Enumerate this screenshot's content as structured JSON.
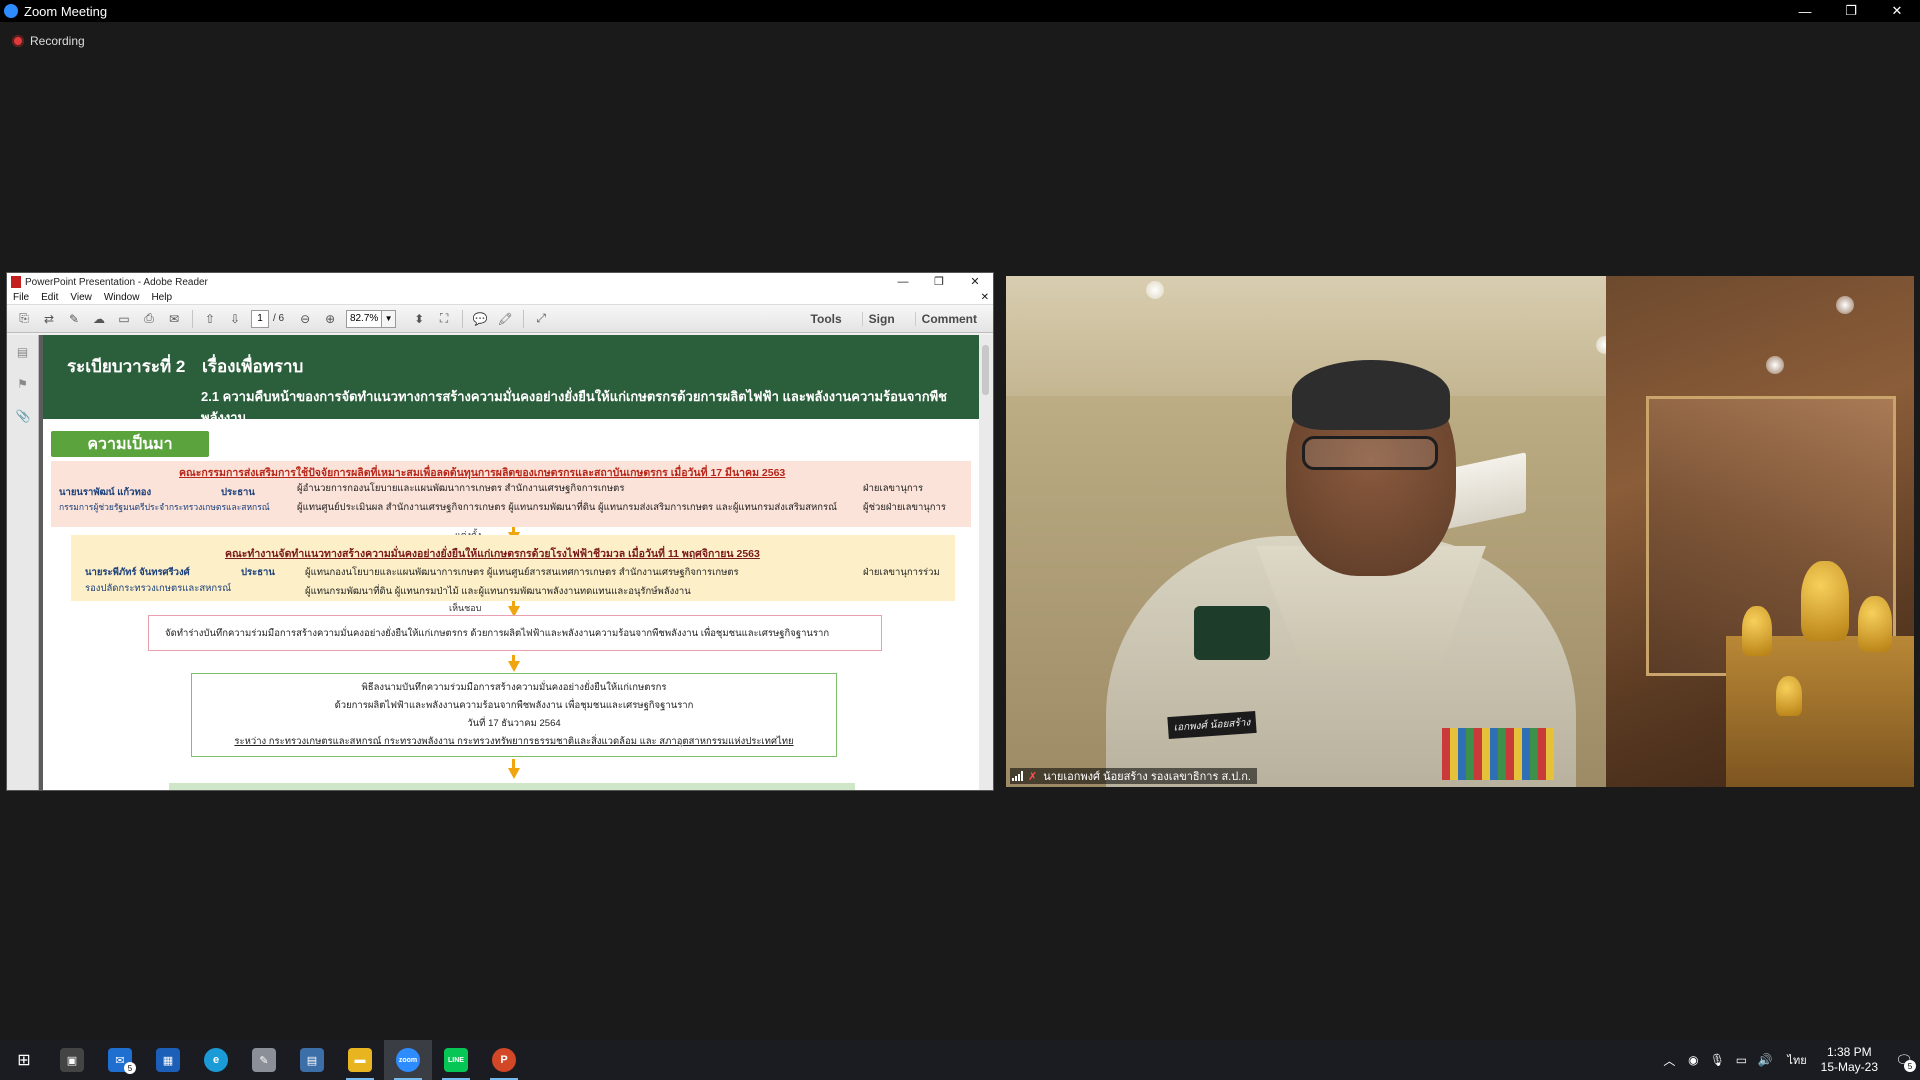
{
  "window": {
    "title": "Zoom Meeting",
    "minimize": "—",
    "restore": "❐",
    "close": "✕"
  },
  "recording": {
    "label": "Recording"
  },
  "adobe": {
    "title": "PowerPoint Presentation - Adobe Reader",
    "menu": [
      "File",
      "Edit",
      "View",
      "Window",
      "Help"
    ],
    "menu_close": "✕",
    "page_current": "1",
    "page_total": "/ 6",
    "zoom": "82.7%",
    "right_tools": [
      "Tools",
      "Sign",
      "Comment"
    ]
  },
  "slide": {
    "agenda": "ระเบียบวาระที่ 2",
    "agenda_topic": "เรื่องเพื่อทราบ",
    "subtitle": "2.1 ความคืบหน้าของการจัดทำแนวทางการสร้างความมั่นคงอย่างยั่งยืนให้แก่เกษตรกรด้วยการผลิตไฟฟ้า และพลังงานความร้อนจากพืชพลังงาน",
    "tag": "ความเป็นมา",
    "box1": {
      "head": "คณะกรรมการส่งเสริมการใช้ปัจจัยการผลิตที่เหมาะสมเพื่อลดต้นทุนการผลิตของเกษตรกรและสถาบันเกษตรกร เมื่อวันที่ 17 มีนาคม 2563",
      "chair_name": "นายนราพัฒน์ แก้วทอง",
      "chair_role": "ประธาน",
      "chair_pos": "กรรมการผู้ช่วยรัฐมนตรีประจำกระทรวงเกษตรและสหกรณ์",
      "line1": "ผู้อำนวยการกองนโยบายและแผนพัฒนาการเกษตร สำนักงานเศรษฐกิจการเกษตร",
      "line2": "ผู้แทนศูนย์ประเมินผล สำนักงานเศรษฐกิจการเกษตร ผู้แทนกรมพัฒนาที่ดิน ผู้แทนกรมส่งเสริมการเกษตร และผู้แทนกรมส่งเสริมสหกรณ์",
      "sec1": "ฝ่ายเลขานุการ",
      "sec2": "ผู้ช่วยฝ่ายเลขานุการ"
    },
    "label_appoint": "แต่งตั้ง",
    "box2": {
      "head": "คณะทำงานจัดทำแนวทางสร้างความมั่นคงอย่างยั่งยืนให้แก่เกษตรกรด้วยโรงไฟฟ้าชีวมวล เมื่อวันที่ 11 พฤศจิกายน 2563",
      "chair_name": "นายระพีภัทร์ จันทรศรีวงศ์",
      "chair_role": "ประธาน",
      "chair_pos": "รองปลัดกระทรวงเกษตรและสหกรณ์",
      "line1": "ผู้แทนกองนโยบายและแผนพัฒนาการเกษตร ผู้แทนศูนย์สารสนเทศการเกษตร สำนักงานเศรษฐกิจการเกษตร",
      "line2": "ผู้แทนกรมพัฒนาที่ดิน ผู้แทนกรมป่าไม้ และผู้แทนกรมพัฒนาพลังงานทดแทนและอนุรักษ์พลังงาน",
      "sec": "ฝ่ายเลขานุการร่วม"
    },
    "label_approve": "เห็นชอบ",
    "box3": "จัดทำร่างบันทึกความร่วมมือการสร้างความมั่นคงอย่างยั่งยืนให้แก่เกษตรกร ด้วยการผลิตไฟฟ้าและพลังงานความร้อนจากพืชพลังงาน เพื่อชุมชนและเศรษฐกิจฐานราก",
    "box4": {
      "l1": "พิธีลงนามบันทึกความร่วมมือการสร้างความมั่นคงอย่างยั่งยืนให้แก่เกษตรกร",
      "l2": "ด้วยการผลิตไฟฟ้าและพลังงานความร้อนจากพืชพลังงาน เพื่อชุมชนและเศรษฐกิจฐานราก",
      "l3": "วันที่ 17 ธันวาคม 2564",
      "l4": "ระหว่าง กระทรวงเกษตรและสหกรณ์ กระทรวงพลังงาน กระทรวงทรัพยากรธรรมชาติและสิ่งแวดล้อม และ สภาอุตสาหกรรมแห่งประเทศไทย"
    }
  },
  "video": {
    "participant": "นายเอกพงศ์ น้อยสร้าง รองเลขาธิการ ส.ป.ก.",
    "nametag": "เอกพงศ์ น้อยสร้าง"
  },
  "taskbar": {
    "apps": [
      {
        "name": "start",
        "label": "⊞"
      },
      {
        "name": "terminal",
        "label": "▣"
      },
      {
        "name": "mail",
        "label": "✉",
        "badge": "5"
      },
      {
        "name": "calendar",
        "label": "▦"
      },
      {
        "name": "edge",
        "label": "e"
      },
      {
        "name": "paint",
        "label": "✎"
      },
      {
        "name": "calculator",
        "label": "▤"
      },
      {
        "name": "explorer",
        "label": "▬"
      },
      {
        "name": "zoom",
        "label": "zoom"
      },
      {
        "name": "line",
        "label": "LINE"
      },
      {
        "name": "powerpoint",
        "label": "P"
      }
    ],
    "lang": "ไทย",
    "time": "1:38 PM",
    "date": "15-May-23",
    "notif_count": "5"
  }
}
